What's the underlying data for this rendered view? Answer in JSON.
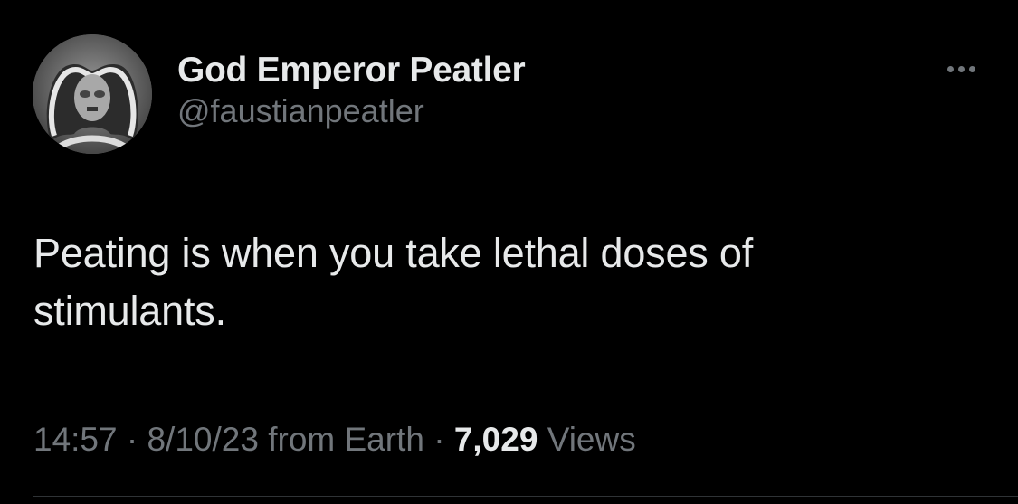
{
  "author": {
    "display_name": "God Emperor Peatler",
    "handle": "@faustianpeatler",
    "avatar_icon": "profile-avatar-icon"
  },
  "more_icon": "ellipsis-horizontal-icon",
  "tweet": {
    "text": "Peating is when you take lethal doses of stimulants.",
    "time": "14:57",
    "date": "8/10/23",
    "source": "from Earth",
    "separator": "·",
    "views_count": "7,029",
    "views_label": "Views"
  },
  "colors": {
    "background": "#000000",
    "primary_text": "#e7e9ea",
    "secondary_text": "#71767b",
    "divider": "#2f3336"
  }
}
